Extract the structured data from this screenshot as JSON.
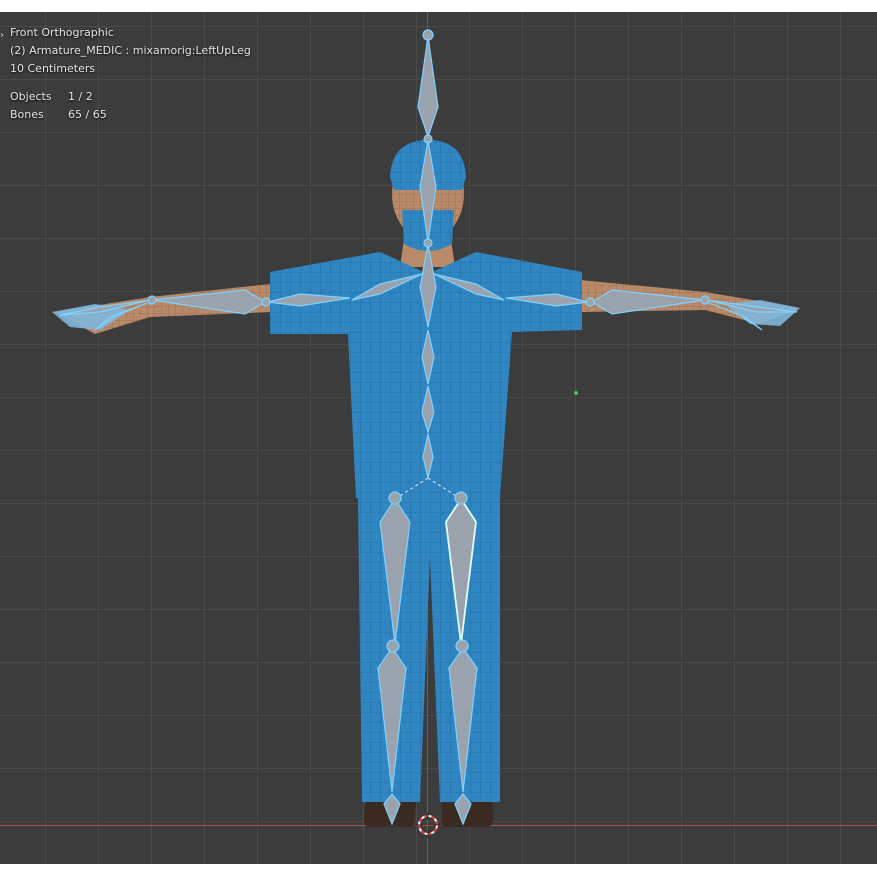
{
  "viewport": {
    "view_name": "Front Orthographic",
    "active": "(2) Armature_MEDIC : mixamorig:LeftUpLeg",
    "scale": "10 Centimeters",
    "stats": [
      {
        "label": "Objects",
        "value": "1 / 2"
      },
      {
        "label": "Bones",
        "value": "65 / 65"
      }
    ]
  },
  "colors": {
    "background": "#3c3c3c",
    "grid": "#4a4a4a",
    "scrubs": "#2f86c2",
    "bone": "#9aa3ad",
    "bone_outline": "#7fd2ff",
    "x_axis": "#b34a4a",
    "z_axis": "#3d6fb0"
  },
  "icons": {
    "collapse": "chevron-right-icon",
    "cursor": "3d-cursor-icon",
    "origin": "object-origin-icon"
  }
}
